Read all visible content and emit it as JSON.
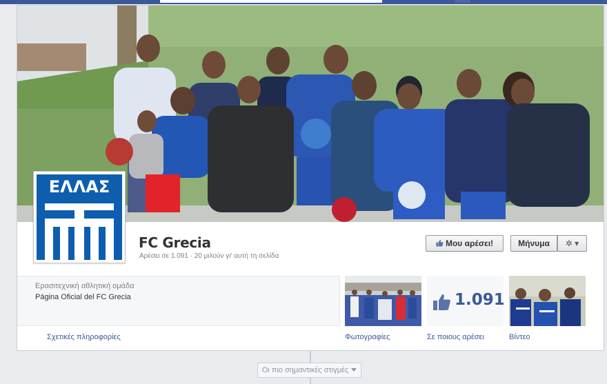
{
  "page": {
    "name": "FC Grecia",
    "stats": "Αρέσει σε 1.091 · 20 μιλούν γι' αυτή τη σελίδα",
    "profile_flag_text": "ΕΛΛΑΣ"
  },
  "actions": {
    "like_label": "Μου αρέσει!",
    "message_label": "Μήνυμα",
    "gear_symbol": "✲ ▾"
  },
  "about": {
    "category": "Ερασιτεχνική αθλητική ομάδα",
    "description": "Página Oficial del FC Grecia"
  },
  "apps": {
    "likes_count": "1.091"
  },
  "tabs": {
    "info": "Σχετικές πληροφορίες",
    "photos": "Φωτογραφίες",
    "likes": "Σε ποιους αρέσει",
    "videos": "Βίντεο"
  },
  "timeline": {
    "highlights_label": "Οι πιο σημαντικές στιγμές"
  },
  "colors": {
    "brand": "#3b5998",
    "flag_blue": "#0d5eaf",
    "cover_wall": "#8daa6e"
  },
  "icons": [
    "thumbs-up-icon",
    "gear-icon",
    "chevron-down-icon"
  ]
}
